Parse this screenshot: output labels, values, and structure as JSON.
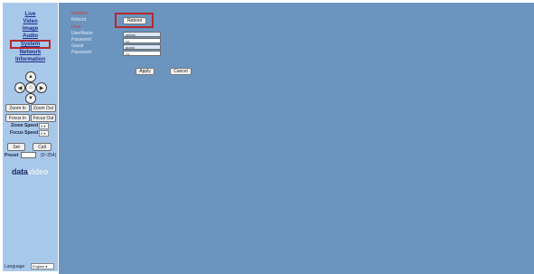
{
  "sidebar": {
    "nav": [
      "Live",
      "Video",
      "Image",
      "Audio",
      "System",
      "Network",
      "Information"
    ],
    "active_nav": "System",
    "zoom_in": "Zoom In",
    "zoom_out": "Zoom Out",
    "focus_in": "Focus In",
    "focus_out": "Focus Out",
    "zoom_speed_label": "Zoom Speed",
    "zoom_speed_value": "5",
    "focus_speed_label": "Focus Speed",
    "focus_speed_value": "5",
    "set": "Set",
    "call": "Call",
    "preset_label": "Preset",
    "preset_range": "(0~254)",
    "logo_part1": "data",
    "logo_part2": "video",
    "language_label": "Language",
    "language_value": "English"
  },
  "main": {
    "section1_title": "Initialize",
    "reboot_label": "Reboot",
    "reboot_button": "Reboot",
    "section2_title": "User",
    "username_label": "UserName",
    "username_value": "admin",
    "password1_label": "Password",
    "password1_value": "•••",
    "guest_label": "Guest",
    "guest_value": "guest",
    "password2_label": "Password",
    "password2_value": "•••",
    "apply_button": "Apply",
    "cancel_button": "Cancel"
  },
  "colors": {
    "sidebar_bg": "#a8c8ea",
    "main_bg": "#6b95bf",
    "nav_link": "#1a2b8a",
    "highlight_box": "#b5282f",
    "section_title": "#c74040"
  }
}
